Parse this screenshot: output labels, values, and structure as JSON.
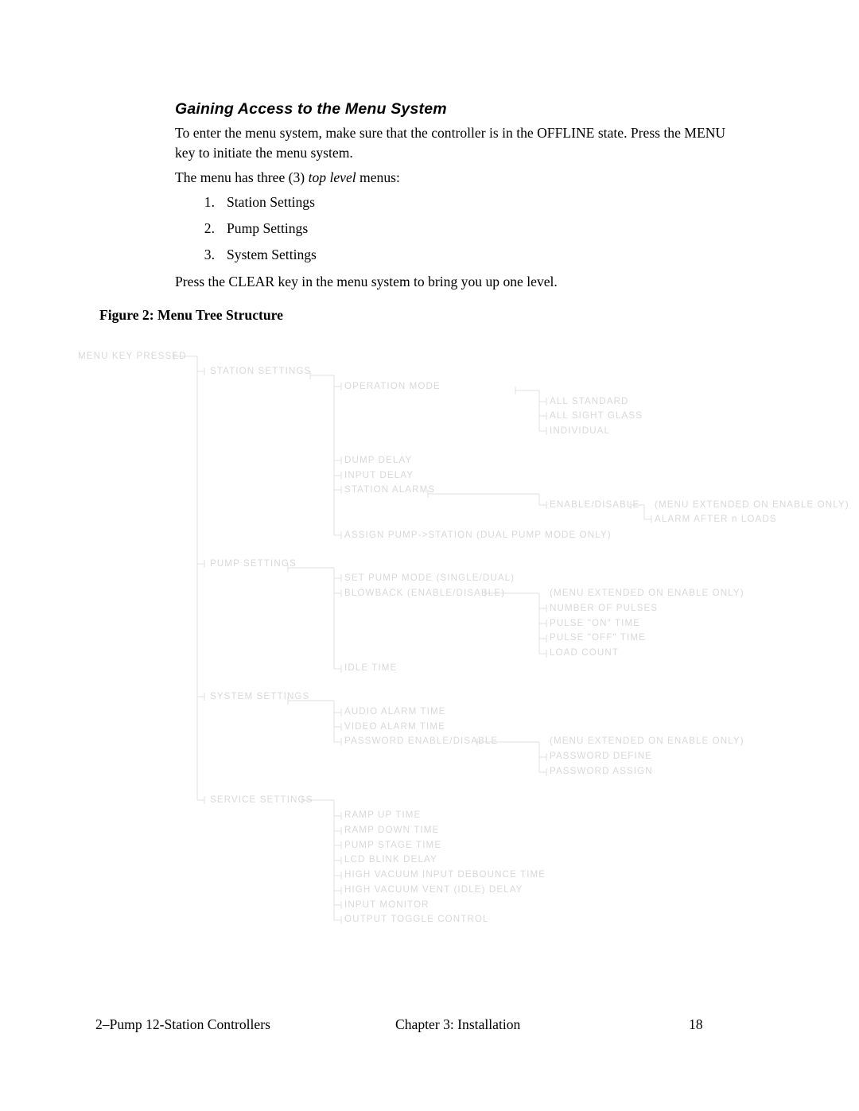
{
  "page": {
    "heading": "Gaining Access to the Menu System",
    "intro_paragraph": "To enter the menu system, make sure that the controller is in the OFFLINE state. Press the MENU key to initiate the menu system.",
    "three_menus_pre": "The menu has three (3) ",
    "three_menus_italic": "top level",
    "three_menus_post": " menus:",
    "clear_paragraph": "Press the CLEAR key in the menu system to bring you up one level.",
    "figure_caption": "Figure 2:  Menu Tree Structure"
  },
  "top_level_list": [
    {
      "num": "1.",
      "label": "Station Settings"
    },
    {
      "num": "2.",
      "label": "Pump Settings"
    },
    {
      "num": "3.",
      "label": "System Settings"
    }
  ],
  "tree": {
    "line_color": "#e0e0e0",
    "text_color": "#d8d8d8",
    "root": "MENU KEY PRESSED",
    "nodes": [
      {
        "id": "n0",
        "label": "MENU KEY PRESSED"
      },
      {
        "id": "n1",
        "label": "STATION SETTINGS"
      },
      {
        "id": "n2",
        "label": "OPERATION MODE"
      },
      {
        "id": "n3",
        "label": "ALL STANDARD"
      },
      {
        "id": "n4",
        "label": "ALL SIGHT GLASS"
      },
      {
        "id": "n5",
        "label": "INDIVIDUAL"
      },
      {
        "id": "n6",
        "label": "DUMP DELAY"
      },
      {
        "id": "n7",
        "label": "INPUT DELAY"
      },
      {
        "id": "n8",
        "label": "STATION ALARMS"
      },
      {
        "id": "n9",
        "label": "ENABLE/DISABLE"
      },
      {
        "id": "n10",
        "label": "(MENU EXTENDED ON ENABLE ONLY)"
      },
      {
        "id": "n11",
        "label": "ALARM AFTER n LOADS"
      },
      {
        "id": "n12",
        "label": "ASSIGN PUMP->STATION (DUAL PUMP MODE ONLY)"
      },
      {
        "id": "n13",
        "label": "PUMP SETTINGS"
      },
      {
        "id": "n14",
        "label": "SET PUMP MODE (SINGLE/DUAL)"
      },
      {
        "id": "n15",
        "label": "BLOWBACK (ENABLE/DISABLE)"
      },
      {
        "id": "n16",
        "label": "(MENU EXTENDED ON ENABLE ONLY)"
      },
      {
        "id": "n17",
        "label": "NUMBER OF PULSES"
      },
      {
        "id": "n18",
        "label": "PULSE \"ON\" TIME"
      },
      {
        "id": "n19",
        "label": "PULSE \"OFF\" TIME"
      },
      {
        "id": "n20",
        "label": "LOAD COUNT"
      },
      {
        "id": "n21",
        "label": "IDLE TIME"
      },
      {
        "id": "n22",
        "label": "SYSTEM SETTINGS"
      },
      {
        "id": "n23",
        "label": "AUDIO ALARM TIME"
      },
      {
        "id": "n24",
        "label": "VIDEO ALARM TIME"
      },
      {
        "id": "n25",
        "label": "PASSWORD ENABLE/DISABLE"
      },
      {
        "id": "n26",
        "label": "(MENU EXTENDED ON ENABLE ONLY)"
      },
      {
        "id": "n27",
        "label": "PASSWORD DEFINE"
      },
      {
        "id": "n28",
        "label": "PASSWORD ASSIGN"
      },
      {
        "id": "n29",
        "label": "SERVICE SETTINGS"
      },
      {
        "id": "n30",
        "label": "RAMP UP TIME"
      },
      {
        "id": "n31",
        "label": "RAMP DOWN TIME"
      },
      {
        "id": "n32",
        "label": "PUMP STAGE TIME"
      },
      {
        "id": "n33",
        "label": "LCD BLINK DELAY"
      },
      {
        "id": "n34",
        "label": "HIGH VACUUM INPUT DEBOUNCE TIME"
      },
      {
        "id": "n35",
        "label": "HIGH VACUUM VENT (IDLE) DELAY"
      },
      {
        "id": "n36",
        "label": "INPUT MONITOR"
      },
      {
        "id": "n37",
        "label": "OUTPUT TOGGLE CONTROL"
      }
    ]
  },
  "footer": {
    "left": "2–Pump 12-Station Controllers",
    "middle": "Chapter 3:  Installation",
    "page_number": "18"
  }
}
